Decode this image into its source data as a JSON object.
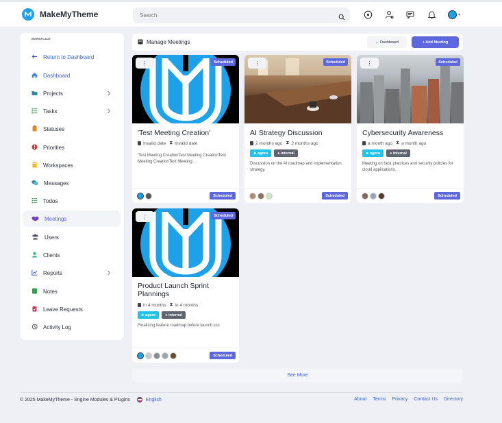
{
  "brand": {
    "name": "MakeMyTheme"
  },
  "search": {
    "placeholder": "Search"
  },
  "sidebar": {
    "caption": "WORKPLACE",
    "items": [
      {
        "label": "Return to Dashboard",
        "icon": "arrow-left-icon"
      },
      {
        "label": "Dashboard",
        "icon": "home-icon"
      },
      {
        "label": "Projects",
        "icon": "folder-icon"
      },
      {
        "label": "Tasks",
        "icon": "list-icon"
      },
      {
        "label": "Statuses",
        "icon": "clipboard-icon"
      },
      {
        "label": "Priorities",
        "icon": "alert-icon"
      },
      {
        "label": "Workspaces",
        "icon": "bookmark-icon"
      },
      {
        "label": "Messages",
        "icon": "chat-icon"
      },
      {
        "label": "Todos",
        "icon": "checklist-icon"
      },
      {
        "label": "Meetings",
        "icon": "handshake-icon"
      },
      {
        "label": "Users",
        "icon": "users-icon"
      },
      {
        "label": "Clients",
        "icon": "client-icon"
      },
      {
        "label": "Reports",
        "icon": "chart-icon"
      },
      {
        "label": "Notes",
        "icon": "note-icon"
      },
      {
        "label": "Leave Requests",
        "icon": "clipboard-check-icon"
      },
      {
        "label": "Activity Log",
        "icon": "history-icon"
      }
    ]
  },
  "manage": {
    "title": "Manage Meetings",
    "dashboard_btn": "← Dashboard",
    "add_btn": "+ Add Meeting"
  },
  "cards": [
    {
      "title": "'Test Meeting Creation'",
      "date_a": "Invalid date",
      "date_b": "Invalid date",
      "tags": [],
      "desc": "'Test Meeting CreationTest Meeting CreationTest Meeting CreationTest Meeting...",
      "badge": "Scheduled",
      "status": "Scheduled",
      "kebab": "⋮"
    },
    {
      "title": "AI Strategy Discussion",
      "date_a": "2 months ago",
      "date_b": "2 months ago",
      "tags": [
        "agora",
        "internal"
      ],
      "desc": "Discussion on the AI roadmap and implementation strategy.",
      "badge": "Scheduled",
      "status": "Scheduled",
      "kebab": "⋮"
    },
    {
      "title": "Cybersecurity Awareness",
      "date_a": "a month ago",
      "date_b": "a month ago",
      "tags": [
        "agora",
        "internal"
      ],
      "desc": "Meeting on best practices and security policies for cloud applications.",
      "badge": "Scheduled",
      "status": "Scheduled",
      "kebab": "⋮"
    },
    {
      "title": "Product Launch Sprint Plannings",
      "date_a": "in 4 months",
      "date_b": "in 4 months",
      "tags": [
        "agora",
        "internal"
      ],
      "desc": "Finalizing feature roadmap before launch.sss",
      "badge": "Scheduled",
      "status": "Scheduled",
      "kebab": "⋮"
    }
  ],
  "see_more": "See More",
  "footer": {
    "copyright": "© 2025 MakeMyTheme - Sngine Modules & Plugins",
    "language": "English",
    "links": [
      "About",
      "Terms",
      "Privacy",
      "Contact Us",
      "Directory"
    ]
  },
  "colors": {
    "accent": "#5d68de",
    "link": "#3d5fcf",
    "agora": "#22c3e6",
    "internal": "#5f6570",
    "brand": "#1ea1e8"
  }
}
